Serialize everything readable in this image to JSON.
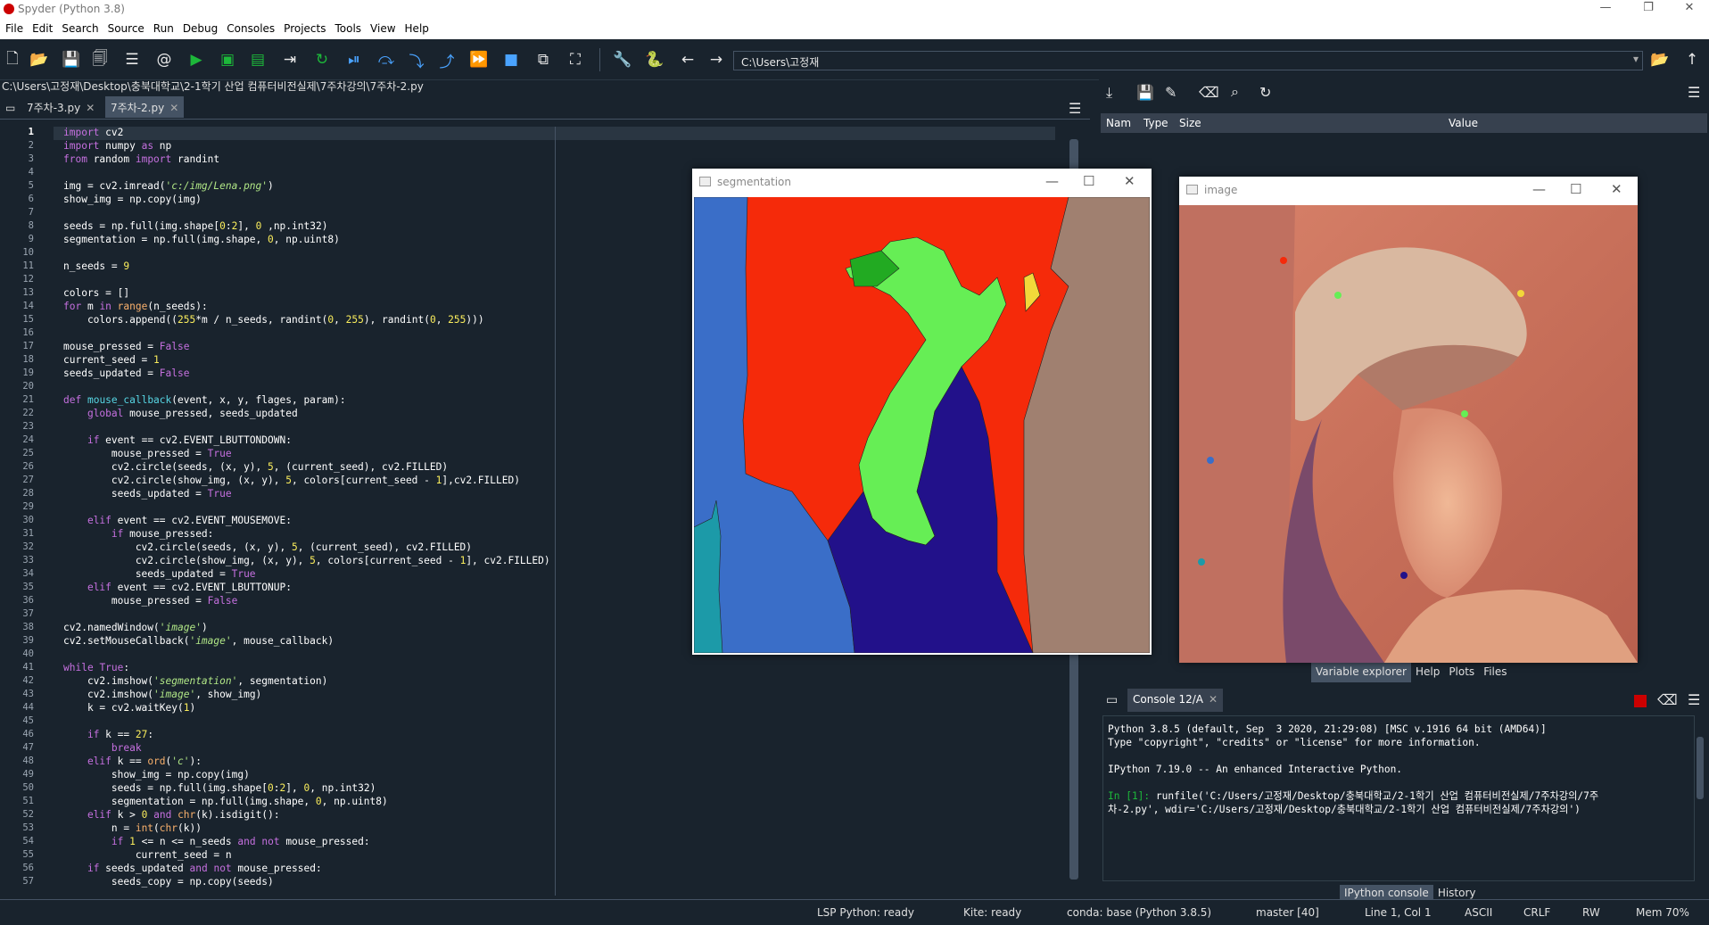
{
  "window": {
    "title": "Spyder (Python 3.8)"
  },
  "menu": [
    "File",
    "Edit",
    "Search",
    "Source",
    "Run",
    "Debug",
    "Consoles",
    "Projects",
    "Tools",
    "View",
    "Help"
  ],
  "toolbar": {
    "path": "C:\\Users\\고정재"
  },
  "editor": {
    "filepath": "C:\\Users\\고정재\\Desktop\\충북대학교\\2-1학기 산업 컴퓨터비전실제\\7주차강의\\7주차-2.py",
    "tabs": [
      {
        "label": "7주차-3.py",
        "active": false
      },
      {
        "label": "7주차-2.py",
        "active": true
      }
    ],
    "lines": [
      "1",
      "2",
      "3",
      "4",
      "5",
      "6",
      "7",
      "8",
      "9",
      "10",
      "11",
      "12",
      "13",
      "14",
      "15",
      "16",
      "17",
      "18",
      "19",
      "20",
      "21",
      "22",
      "23",
      "24",
      "25",
      "26",
      "27",
      "28",
      "29",
      "30",
      "31",
      "32",
      "33",
      "34",
      "35",
      "36",
      "37",
      "38",
      "39",
      "40",
      "41",
      "42",
      "43",
      "44",
      "45",
      "46",
      "47",
      "48",
      "49",
      "50",
      "51",
      "52",
      "53",
      "54",
      "55",
      "56",
      "57"
    ]
  },
  "variable_explorer": {
    "columns": [
      "Nam",
      "Type",
      "Size",
      "Value"
    ]
  },
  "right_top_tabs": [
    "Variable explorer",
    "Help",
    "Plots",
    "Files"
  ],
  "console": {
    "tab_label": "Console 12/A",
    "lines": [
      "Python 3.8.5 (default, Sep  3 2020, 21:29:08) [MSC v.1916 64 bit (AMD64)]",
      "Type \"copyright\", \"credits\" or \"license\" for more information.",
      "",
      "IPython 7.19.0 -- An enhanced Interactive Python.",
      ""
    ],
    "prompt": "In [1]:",
    "command_1": " runfile('C:/Users/고정재/Desktop/충북대학교/2-1학기 산업 컴퓨터비전실제/7주차강의/7주",
    "command_2": "차-2.py', wdir='C:/Users/고정재/Desktop/충북대학교/2-1학기 산업 컴퓨터비전실제/7주차강의')"
  },
  "right_bottom_tabs": [
    "IPython console",
    "History"
  ],
  "statusbar": {
    "lsp": "LSP Python: ready",
    "kite": "Kite: ready",
    "conda": "conda: base (Python 3.8.5)",
    "git": "master [40]",
    "position": "Line 1, Col 1",
    "encoding": "ASCII",
    "eol": "CRLF",
    "rw": "RW",
    "mem": "Mem 70%"
  },
  "windows": {
    "segmentation": {
      "title": "segmentation"
    },
    "image": {
      "title": "image"
    }
  },
  "colors": {
    "seg_red": "#f52a0a",
    "seg_green": "#66ee55",
    "seg_darkgreen": "#22aa22",
    "seg_blue": "#3a6ec8",
    "seg_navy": "#22118a",
    "seg_teal": "#1c9aa8",
    "seg_brown": "#a08070",
    "seg_yellow": "#f2d83a"
  }
}
